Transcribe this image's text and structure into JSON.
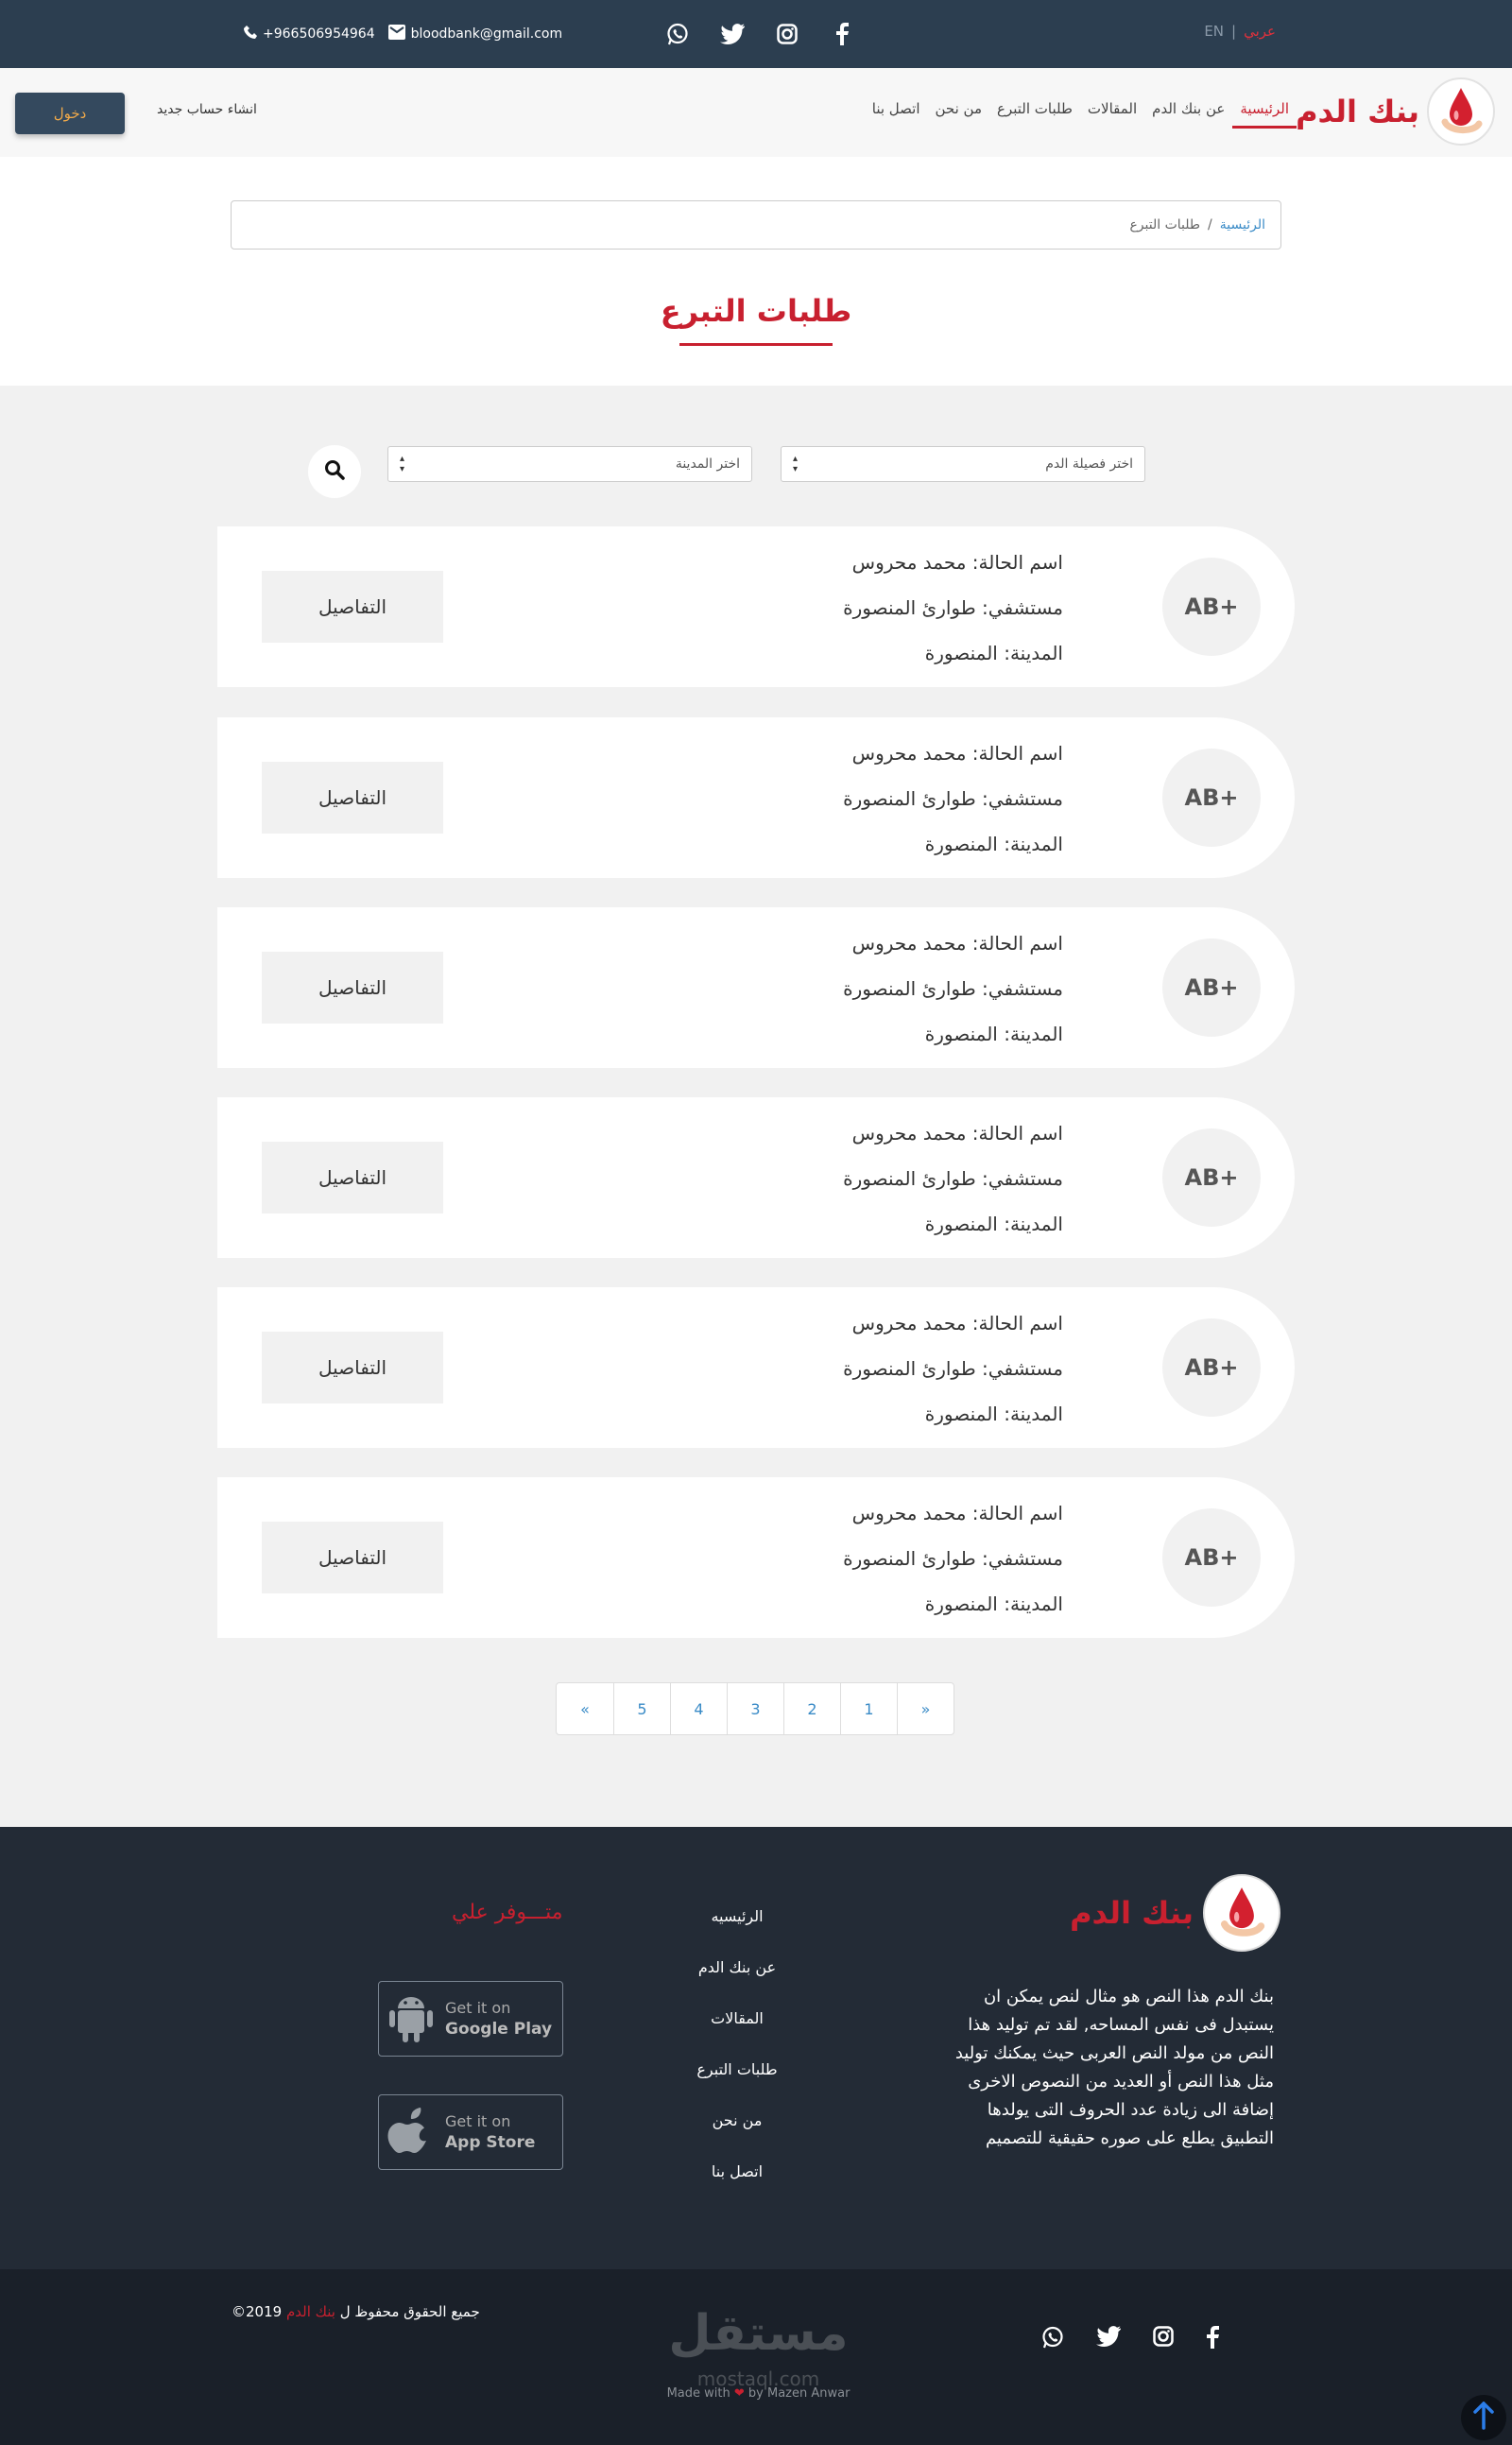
{
  "topbar": {
    "lang_ar": "عربي",
    "lang_en": "EN",
    "phone": "+966506954964",
    "email": "bloodbank@gmail.com",
    "social_icons": [
      "whatsapp-icon",
      "twitter-icon",
      "instagram-icon",
      "facebook-icon"
    ]
  },
  "nav": {
    "logo_text": "بنك الدم",
    "items": [
      "الرئيسية",
      "عن بنك الدم",
      "المقالات",
      "طلبات التبرع",
      "من نحن",
      "اتصل بنا"
    ],
    "active_index": 0,
    "signup": "انشاء حساب جديد",
    "login": "دخول"
  },
  "breadcrumb": {
    "home": "الرئيسية",
    "separator": "/",
    "current": "طلبات التبرع"
  },
  "page_title": "طلبات التبرع",
  "filters": {
    "blood_type_placeholder": "اختر فصيلة الدم",
    "city_placeholder": "اختر المدينة",
    "search_icon": "search-icon"
  },
  "requests": [
    {
      "blood_type": "AB+",
      "patient": "اسم الحالة: محمد محروس",
      "hospital": "مستشفي: طوارئ المنصورة",
      "city": "المدينة: المنصورة",
      "details": "التفاصيل"
    },
    {
      "blood_type": "AB+",
      "patient": "اسم الحالة: محمد محروس",
      "hospital": "مستشفي: طوارئ المنصورة",
      "city": "المدينة: المنصورة",
      "details": "التفاصيل"
    },
    {
      "blood_type": "AB+",
      "patient": "اسم الحالة: محمد محروس",
      "hospital": "مستشفي: طوارئ المنصورة",
      "city": "المدينة: المنصورة",
      "details": "التفاصيل"
    },
    {
      "blood_type": "AB+",
      "patient": "اسم الحالة: محمد محروس",
      "hospital": "مستشفي: طوارئ المنصورة",
      "city": "المدينة: المنصورة",
      "details": "التفاصيل"
    },
    {
      "blood_type": "AB+",
      "patient": "اسم الحالة: محمد محروس",
      "hospital": "مستشفي: طوارئ المنصورة",
      "city": "المدينة: المنصورة",
      "details": "التفاصيل"
    },
    {
      "blood_type": "AB+",
      "patient": "اسم الحالة: محمد محروس",
      "hospital": "مستشفي: طوارئ المنصورة",
      "city": "المدينة: المنصورة",
      "details": "التفاصيل"
    }
  ],
  "pagination": {
    "prev": "«",
    "pages": [
      "1",
      "2",
      "3",
      "4",
      "5"
    ],
    "next": "»"
  },
  "footer": {
    "logo_text": "بنك الدم",
    "description": "بنك الدم هذا النص هو مثال لنص يمكن ان يستبدل فى نفس المساحه, لقد تم توليد هذا النص من مولد النص العربى حيث يمكنك توليد مثل هذا النص أو العديد من النصوص الاخرى إضافة الى زيادة عدد الحروف التى يولدها التطبيق يطلع على صوره حقيقية للتصميم",
    "links": [
      "الرئيسيه",
      "عن بنك الدم",
      "المقالات",
      "طلبات التبرع",
      "من نحن",
      "اتصل بنا"
    ],
    "available_on": "متـــوفر علي",
    "google_play": {
      "small": "Get it on",
      "big": "Google Play"
    },
    "app_store": {
      "small": "Get it on",
      "big": "App Store"
    }
  },
  "bottom": {
    "copyright_prefix": "جميع الحقوق محفوظ ل",
    "copyright_brand": "بنك الدم",
    "copyright_year": "2019©",
    "watermark": "مستقل",
    "watermark_sub": "mostaql.com",
    "made_with": "Made with",
    "made_by": "by Mazen Anwar"
  },
  "colors": {
    "brand_red": "#c8202f",
    "topbar": "#2c3e50",
    "footer": "#232b36",
    "link_blue": "#3a8bc7"
  }
}
